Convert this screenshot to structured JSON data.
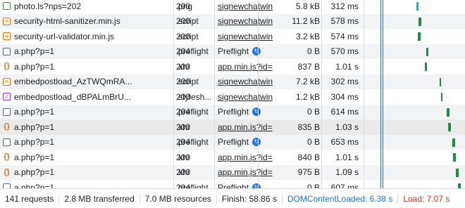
{
  "rows": [
    {
      "name": "photo.ls?nps=202",
      "status": "200",
      "type": "png",
      "initiator": "signewchatwin",
      "size": "5.8 kB",
      "time": "312 ms",
      "icon": "image-icon"
    },
    {
      "name": "security-html-sanitizer.min.js",
      "status": "200",
      "type": "script",
      "initiator": "signewchatwin",
      "size": "11.2 kB",
      "time": "578 ms",
      "icon": "script-icon"
    },
    {
      "name": "security-url-validator.min.js",
      "status": "200",
      "type": "script",
      "initiator": "signewchatwin",
      "size": "3.2 kB",
      "time": "574 ms",
      "icon": "script-icon"
    },
    {
      "name": "a.php?p=1",
      "status": "204",
      "type": "preflight",
      "initiator": "Preflight",
      "size": "0 B",
      "time": "570 ms",
      "icon": "document-icon"
    },
    {
      "name": "a.php?p=1",
      "status": "200",
      "type": "xhr",
      "initiator": "app.min.js?id=",
      "size": "837 B",
      "time": "1.01 s",
      "icon": "xhr-icon"
    },
    {
      "name": "embedpostload_AzTWQmRA...",
      "status": "200",
      "type": "script",
      "initiator": "signewchatwin",
      "size": "7.2 kB",
      "time": "302 ms",
      "icon": "script-icon"
    },
    {
      "name": "embedpostload_dBPALmBrU...",
      "status": "200",
      "type": "stylesh...",
      "initiator": "signewchatwin",
      "size": "1.2 kB",
      "time": "304 ms",
      "icon": "stylesheet-icon"
    },
    {
      "name": "a.php?p=1",
      "status": "204",
      "type": "preflight",
      "initiator": "Preflight",
      "size": "0 B",
      "time": "614 ms",
      "icon": "document-icon"
    },
    {
      "name": "a.php?p=1",
      "status": "200",
      "type": "xhr",
      "initiator": "app.min.js?id=",
      "size": "835 B",
      "time": "1.03 s",
      "icon": "xhr-icon"
    },
    {
      "name": "a.php?p=1",
      "status": "204",
      "type": "preflight",
      "initiator": "Preflight",
      "size": "0 B",
      "time": "653 ms",
      "icon": "document-icon"
    },
    {
      "name": "a.php?p=1",
      "status": "200",
      "type": "xhr",
      "initiator": "app.min.js?id=",
      "size": "840 B",
      "time": "1.01 s",
      "icon": "xhr-icon"
    },
    {
      "name": "a.php?p=1",
      "status": "200",
      "type": "xhr",
      "initiator": "app.min.js?id=",
      "size": "975 B",
      "time": "1.09 s",
      "icon": "xhr-icon"
    },
    {
      "name": "a.php?p=1",
      "status": "204",
      "type": "preflight",
      "initiator": "Preflight",
      "size": "0 B",
      "time": "607 ms",
      "icon": "document-icon"
    }
  ],
  "statusbar": {
    "requests": "141 requests",
    "transferred": "2.8 MB transferred",
    "resources": "7.0 MB resources",
    "finish": "Finish: 58.86 s",
    "domcontentloaded": "DOMContentLoaded: 6.38 s",
    "load": "Load: 7.07 s"
  },
  "colors": {
    "domcontentloaded": "#1a73e8",
    "load": "#d93025",
    "waterfall_bar": "#1e8e3e"
  }
}
